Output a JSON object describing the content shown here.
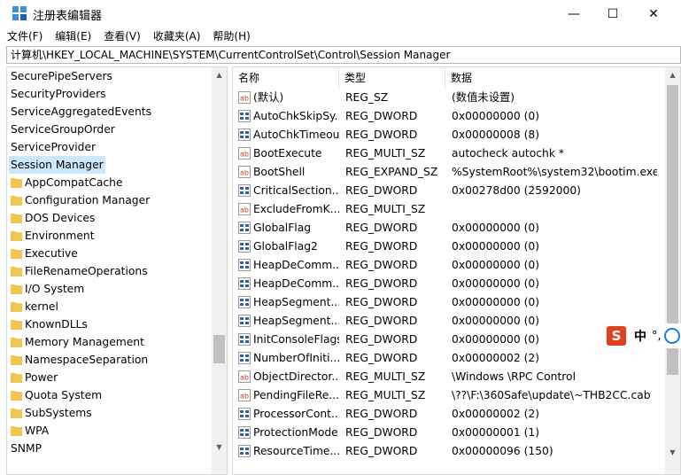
{
  "window": {
    "title": "注册表编辑器",
    "minimize_glyph": "—",
    "maximize_glyph": "☐",
    "close_glyph": "✕"
  },
  "menu": {
    "items": [
      "文件(F)",
      "编辑(E)",
      "查看(V)",
      "收藏夹(A)",
      "帮助(H)"
    ]
  },
  "address": {
    "path": "计算机\\HKEY_LOCAL_MACHINE\\SYSTEM\\CurrentControlSet\\Control\\Session Manager"
  },
  "tree": {
    "items": [
      {
        "label": "SecurePipeServers",
        "folder": false,
        "selected": false
      },
      {
        "label": "SecurityProviders",
        "folder": false,
        "selected": false
      },
      {
        "label": "ServiceAggregatedEvents",
        "folder": false,
        "selected": false
      },
      {
        "label": "ServiceGroupOrder",
        "folder": false,
        "selected": false
      },
      {
        "label": "ServiceProvider",
        "folder": false,
        "selected": false
      },
      {
        "label": "Session Manager",
        "folder": false,
        "selected": true
      },
      {
        "label": "AppCompatCache",
        "folder": true,
        "selected": false
      },
      {
        "label": "Configuration Manager",
        "folder": true,
        "selected": false
      },
      {
        "label": "DOS Devices",
        "folder": true,
        "selected": false
      },
      {
        "label": "Environment",
        "folder": true,
        "selected": false
      },
      {
        "label": "Executive",
        "folder": true,
        "selected": false
      },
      {
        "label": "FileRenameOperations",
        "folder": true,
        "selected": false
      },
      {
        "label": "I/O System",
        "folder": true,
        "selected": false
      },
      {
        "label": "kernel",
        "folder": true,
        "selected": false
      },
      {
        "label": "KnownDLLs",
        "folder": true,
        "selected": false
      },
      {
        "label": "Memory Management",
        "folder": true,
        "selected": false
      },
      {
        "label": "NamespaceSeparation",
        "folder": true,
        "selected": false
      },
      {
        "label": "Power",
        "folder": true,
        "selected": false
      },
      {
        "label": "Quota System",
        "folder": true,
        "selected": false
      },
      {
        "label": "SubSystems",
        "folder": true,
        "selected": false
      },
      {
        "label": "WPA",
        "folder": true,
        "selected": false
      },
      {
        "label": "SNMP",
        "folder": false,
        "selected": false
      }
    ]
  },
  "list": {
    "columns": {
      "name": "名称",
      "type": "类型",
      "data": "数据"
    },
    "rows": [
      {
        "icon": "string-value-icon",
        "name": "(默认)",
        "type": "REG_SZ",
        "data": "(数值未设置)"
      },
      {
        "icon": "binary-value-icon",
        "name": "AutoChkSkipSy...",
        "type": "REG_DWORD",
        "data": "0x00000000 (0)"
      },
      {
        "icon": "binary-value-icon",
        "name": "AutoChkTimeout",
        "type": "REG_DWORD",
        "data": "0x00000008 (8)"
      },
      {
        "icon": "string-value-icon",
        "name": "BootExecute",
        "type": "REG_MULTI_SZ",
        "data": "autocheck autochk *"
      },
      {
        "icon": "string-value-icon",
        "name": "BootShell",
        "type": "REG_EXPAND_SZ",
        "data": "%SystemRoot%\\system32\\bootim.exe"
      },
      {
        "icon": "binary-value-icon",
        "name": "CriticalSection...",
        "type": "REG_DWORD",
        "data": "0x00278d00 (2592000)"
      },
      {
        "icon": "string-value-icon",
        "name": "ExcludeFromK...",
        "type": "REG_MULTI_SZ",
        "data": ""
      },
      {
        "icon": "binary-value-icon",
        "name": "GlobalFlag",
        "type": "REG_DWORD",
        "data": "0x00000000 (0)"
      },
      {
        "icon": "binary-value-icon",
        "name": "GlobalFlag2",
        "type": "REG_DWORD",
        "data": "0x00000000 (0)"
      },
      {
        "icon": "binary-value-icon",
        "name": "HeapDeComm...",
        "type": "REG_DWORD",
        "data": "0x00000000 (0)"
      },
      {
        "icon": "binary-value-icon",
        "name": "HeapDeComm...",
        "type": "REG_DWORD",
        "data": "0x00000000 (0)"
      },
      {
        "icon": "binary-value-icon",
        "name": "HeapSegment...",
        "type": "REG_DWORD",
        "data": "0x00000000 (0)"
      },
      {
        "icon": "binary-value-icon",
        "name": "HeapSegment...",
        "type": "REG_DWORD",
        "data": "0x00000000 (0)"
      },
      {
        "icon": "binary-value-icon",
        "name": "InitConsoleFlags",
        "type": "REG_DWORD",
        "data": "0x00000000 (0)"
      },
      {
        "icon": "binary-value-icon",
        "name": "NumberOfIniti...",
        "type": "REG_DWORD",
        "data": "0x00000002 (2)"
      },
      {
        "icon": "string-value-icon",
        "name": "ObjectDirector...",
        "type": "REG_MULTI_SZ",
        "data": "\\Windows \\RPC Control"
      },
      {
        "icon": "string-value-icon",
        "name": "PendingFileRe...",
        "type": "REG_MULTI_SZ",
        "data": "\\??\\F:\\360Safe\\update\\~THB2CC.cab"
      },
      {
        "icon": "binary-value-icon",
        "name": "ProcessorCont...",
        "type": "REG_DWORD",
        "data": "0x00000002 (2)"
      },
      {
        "icon": "binary-value-icon",
        "name": "ProtectionMode",
        "type": "REG_DWORD",
        "data": "0x00000001 (1)"
      },
      {
        "icon": "binary-value-icon",
        "name": "ResourceTime...",
        "type": "REG_DWORD",
        "data": "0x00000096 (150)"
      }
    ]
  },
  "ime": {
    "logo": "S",
    "mode": "中",
    "punct": "°,"
  },
  "colors": {
    "selection": "#cce8ff",
    "folder": "#f0c552",
    "string_icon": "#c0392b",
    "binary_icon": "#2f5fa8",
    "ime_brand": "#e0421d"
  }
}
